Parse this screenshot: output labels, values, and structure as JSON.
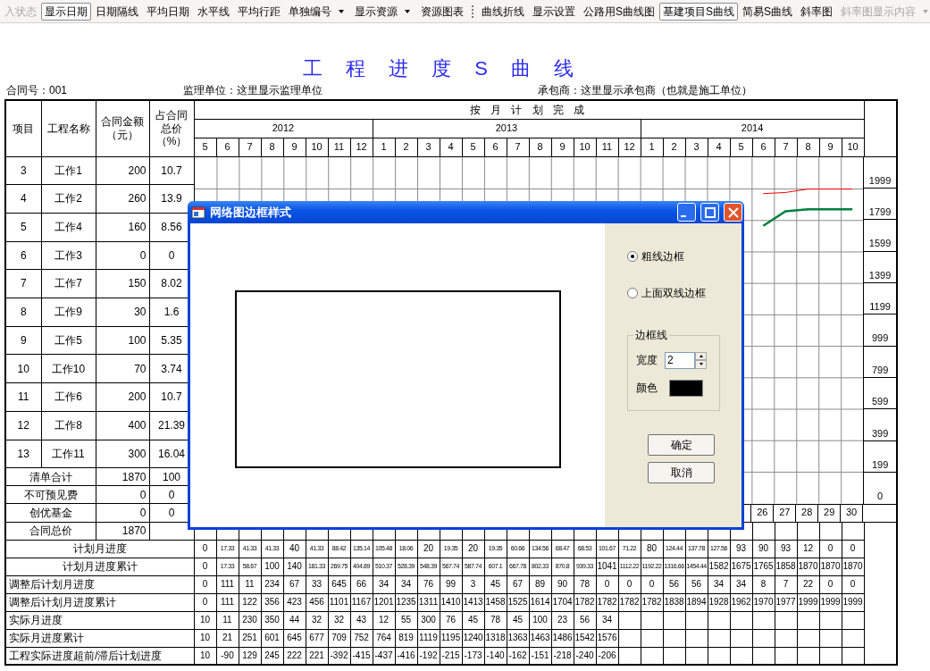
{
  "toolbar": {
    "items": [
      {
        "kind": "button",
        "label": "入状态",
        "pressed": false,
        "disabled": true
      },
      {
        "kind": "button",
        "label": "显示日期",
        "pressed": true,
        "disabled": false
      },
      {
        "kind": "button",
        "label": "日期隔线",
        "pressed": false,
        "disabled": false
      },
      {
        "kind": "button",
        "label": "平均日期",
        "pressed": false,
        "disabled": false
      },
      {
        "kind": "button",
        "label": "水平线",
        "pressed": false,
        "disabled": false
      },
      {
        "kind": "button",
        "label": "平均行距",
        "pressed": false,
        "disabled": false
      },
      {
        "kind": "dropdown",
        "label": "单独编号",
        "pressed": false,
        "disabled": false
      },
      {
        "kind": "dropdown",
        "label": "显示资源",
        "pressed": false,
        "disabled": false
      },
      {
        "kind": "button",
        "label": "资源图表",
        "pressed": false,
        "disabled": false
      },
      {
        "kind": "separator"
      },
      {
        "kind": "button",
        "label": "曲线折线",
        "pressed": false,
        "disabled": false
      },
      {
        "kind": "button",
        "label": "显示设置",
        "pressed": false,
        "disabled": false
      },
      {
        "kind": "button",
        "label": "公路用S曲线图",
        "pressed": false,
        "disabled": false
      },
      {
        "kind": "button",
        "label": "基建项目S曲线",
        "pressed": true,
        "disabled": false
      },
      {
        "kind": "button",
        "label": "简易S曲线",
        "pressed": false,
        "disabled": false
      },
      {
        "kind": "button",
        "label": "斜率图",
        "pressed": false,
        "disabled": false
      },
      {
        "kind": "dropdown",
        "label": "斜率图显示内容",
        "pressed": false,
        "disabled": true
      }
    ]
  },
  "title": "工 程 进 度 S 曲 线",
  "info": {
    "contract_no": "合同号：001",
    "supervisor": "监理单位：这里显示监理单位",
    "contractor": "承包商：这里显示承包商（也就是施工单位）"
  },
  "table": {
    "columns": [
      {
        "lines": [
          "项目"
        ]
      },
      {
        "lines": [
          "工程名称"
        ]
      },
      {
        "lines": [
          "合同金额",
          "（元）"
        ]
      },
      {
        "lines": [
          "占合同",
          "总价",
          "（%）"
        ]
      }
    ],
    "plan_heading": "按 月 计 划 完 成",
    "years": [
      {
        "label": "2012",
        "months": [
          "5",
          "6",
          "7",
          "8",
          "9",
          "10",
          "11",
          "12"
        ]
      },
      {
        "label": "2013",
        "months": [
          "1",
          "2",
          "3",
          "4",
          "5",
          "6",
          "7",
          "8",
          "9",
          "10",
          "11",
          "12"
        ]
      },
      {
        "label": "2014",
        "months": [
          "1",
          "2",
          "3",
          "4",
          "5",
          "6",
          "7",
          "8",
          "9",
          "10"
        ]
      }
    ],
    "rows": [
      {
        "no": "3",
        "name": "工作1",
        "amount": "200",
        "percent": "10.7"
      },
      {
        "no": "4",
        "name": "工作2",
        "amount": "260",
        "percent": "13.9"
      },
      {
        "no": "5",
        "name": "工作4",
        "amount": "160",
        "percent": "8.56"
      },
      {
        "no": "6",
        "name": "工作3",
        "amount": "0",
        "percent": "0"
      },
      {
        "no": "7",
        "name": "工作7",
        "amount": "150",
        "percent": "8.02"
      },
      {
        "no": "8",
        "name": "工作9",
        "amount": "30",
        "percent": "1.6"
      },
      {
        "no": "9",
        "name": "工作5",
        "amount": "100",
        "percent": "5.35"
      },
      {
        "no": "10",
        "name": "工作10",
        "amount": "70",
        "percent": "3.74"
      },
      {
        "no": "11",
        "name": "工作6",
        "amount": "200",
        "percent": "10.7"
      },
      {
        "no": "12",
        "name": "工作8",
        "amount": "400",
        "percent": "21.39"
      },
      {
        "no": "13",
        "name": "工作11",
        "amount": "300",
        "percent": "16.04"
      }
    ],
    "summary_rows": [
      {
        "label": "清单合计",
        "amount": "1870",
        "percent": "100"
      },
      {
        "label": "不可预见费",
        "amount": "0",
        "percent": "0"
      },
      {
        "label": "创优基金",
        "amount": "0",
        "percent": "0"
      },
      {
        "label": "合同总价",
        "amount": "1870"
      }
    ],
    "chart": {
      "chart_data": {
        "type": "line",
        "x": [
          26,
          27,
          28,
          29,
          30
        ],
        "ylim": [
          0,
          2199
        ],
        "grid": true,
        "yticks": [
          0,
          199,
          399,
          599,
          799,
          999,
          1199,
          1399,
          1599,
          1799,
          1999
        ],
        "series": [
          {
            "color": "#ff0000",
            "values": [
              1970,
              1977,
              1999,
              1999,
              1999
            ]
          },
          {
            "color": "#008040",
            "values": [
              1765,
              1858,
              1870,
              1870,
              1870
            ]
          }
        ]
      }
    },
    "progress_rows": [
      {
        "label": "计划月进度",
        "centered": true,
        "values": [
          "0",
          "17.33",
          "41.33",
          "41.33",
          "40",
          "41.33",
          "88.42",
          "135.14",
          "105.48",
          "18.06",
          "20",
          "19.35",
          "20",
          "19.35",
          "60.66",
          "134.56",
          "68.47",
          "68.53",
          "101.67",
          "71.22",
          "80",
          "124.44",
          "137.78",
          "127.56",
          "93",
          "90",
          "93",
          "12",
          "0",
          "0"
        ]
      },
      {
        "label": "计划月进度累计",
        "centered": true,
        "values": [
          "0",
          "17.33",
          "58.67",
          "100",
          "140",
          "181.33",
          "269.75",
          "404.89",
          "510.37",
          "528.39",
          "548.39",
          "567.74",
          "587.74",
          "607.1",
          "667.78",
          "802.33",
          "870.8",
          "939.33",
          "1041",
          "1112.22",
          "1192.22",
          "1316.66",
          "1454.44",
          "1582",
          "1675",
          "1765",
          "1858",
          "1870",
          "1870",
          "1870"
        ]
      },
      {
        "label": "调整后计划月进度",
        "centered": false,
        "values": [
          "0",
          "111",
          "11",
          "234",
          "67",
          "33",
          "645",
          "66",
          "34",
          "34",
          "76",
          "99",
          "3",
          "45",
          "67",
          "89",
          "90",
          "78",
          "0",
          "0",
          "0",
          "56",
          "56",
          "34",
          "34",
          "8",
          "7",
          "22",
          "0",
          "0"
        ]
      },
      {
        "label": "调整后计划月进度累计",
        "centered": false,
        "values": [
          "0",
          "111",
          "122",
          "356",
          "423",
          "456",
          "1101",
          "1167",
          "1201",
          "1235",
          "1311",
          "1410",
          "1413",
          "1458",
          "1525",
          "1614",
          "1704",
          "1782",
          "1782",
          "1782",
          "1782",
          "1838",
          "1894",
          "1928",
          "1962",
          "1970",
          "1977",
          "1999",
          "1999",
          "1999"
        ]
      },
      {
        "label": "实际月进度",
        "centered": false,
        "values": [
          "10",
          "11",
          "230",
          "350",
          "44",
          "32",
          "32",
          "43",
          "12",
          "55",
          "300",
          "76",
          "45",
          "78",
          "45",
          "100",
          "23",
          "56",
          "34"
        ]
      },
      {
        "label": "实际月进度累计",
        "centered": false,
        "values": [
          "10",
          "21",
          "251",
          "601",
          "645",
          "677",
          "709",
          "752",
          "764",
          "819",
          "1119",
          "1195",
          "1240",
          "1318",
          "1363",
          "1463",
          "1486",
          "1542",
          "1576"
        ]
      },
      {
        "label": "工程实际进度超前/滞后计划进度",
        "centered": false,
        "values": [
          "10",
          "-90",
          "129",
          "245",
          "222",
          "221",
          "-392",
          "-415",
          "-437",
          "-416",
          "-192",
          "-215",
          "-173",
          "-140",
          "-162",
          "-151",
          "-218",
          "-240",
          "-206"
        ]
      }
    ]
  },
  "dialog": {
    "title": "网络图边框样式",
    "options": [
      {
        "label": "粗线边框",
        "selected": true
      },
      {
        "label": "上面双线边框",
        "selected": false
      }
    ],
    "group": {
      "legend": "边框线",
      "width_label": "宽度",
      "width_value": "2",
      "color_label": "颜色",
      "color": "#000000"
    },
    "buttons": [
      "确定",
      "取消"
    ]
  }
}
